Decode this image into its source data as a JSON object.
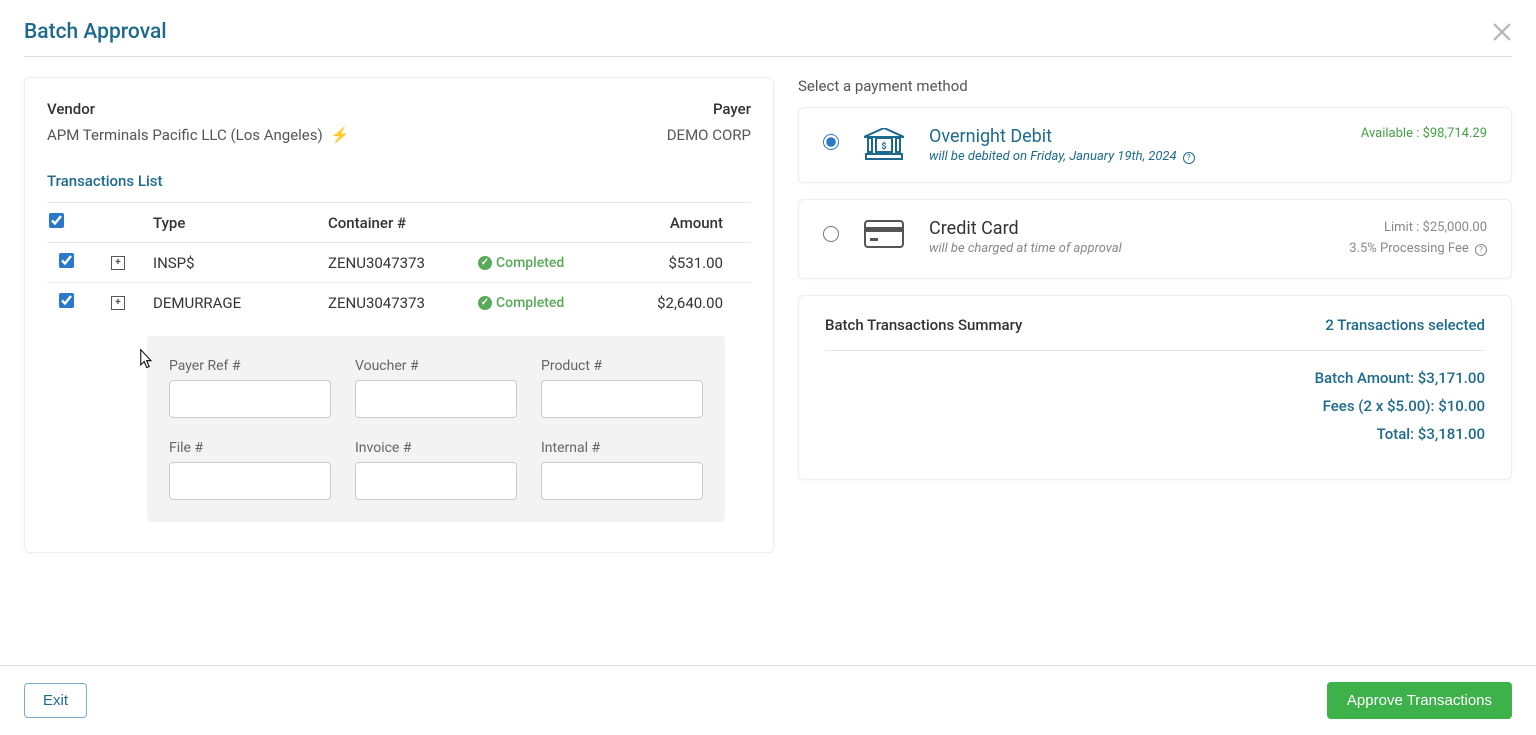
{
  "modal_title": "Batch Approval",
  "vendor_label": "Vendor",
  "vendor_name": "APM Terminals Pacific LLC (Los Angeles)",
  "payer_label": "Payer",
  "payer_name": "DEMO CORP",
  "tx_list_label": "Transactions List",
  "columns": {
    "type": "Type",
    "container": "Container #",
    "amount": "Amount"
  },
  "rows": [
    {
      "type": "INSP$",
      "container": "ZENU3047373",
      "status": "Completed",
      "amount": "$531.00"
    },
    {
      "type": "DEMURRAGE",
      "container": "ZENU3047373",
      "status": "Completed",
      "amount": "$2,640.00"
    }
  ],
  "detail_labels": {
    "payer_ref": "Payer Ref #",
    "voucher": "Voucher #",
    "product": "Product #",
    "file": "File #",
    "invoice": "Invoice #",
    "internal": "Internal #"
  },
  "pay_method_label": "Select a payment method",
  "pm_debit": {
    "name": "Overnight Debit",
    "sub": "will be debited on Friday, January 19th, 2024",
    "available": "Available : $98,714.29"
  },
  "pm_cc": {
    "name": "Credit Card",
    "sub": "will be charged at time of approval",
    "limit": "Limit : $25,000.00",
    "fee_line": "3.5% Processing Fee"
  },
  "summary": {
    "title": "Batch Transactions Summary",
    "selected": "2 Transactions selected",
    "batch_amount": "Batch Amount: $3,171.00",
    "fees": "Fees (2 x $5.00): $10.00",
    "total": "Total: $3,181.00"
  },
  "buttons": {
    "exit": "Exit",
    "approve": "Approve Transactions"
  }
}
